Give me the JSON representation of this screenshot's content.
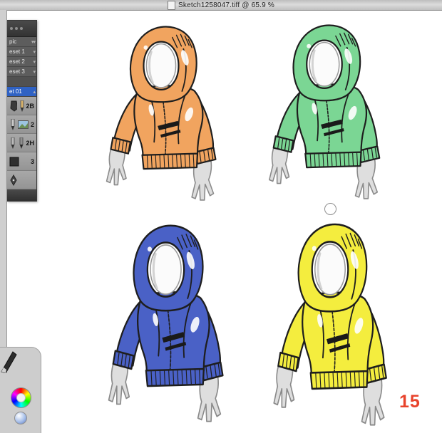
{
  "window": {
    "title": "Sketch1258047.tiff @ 65.9 %"
  },
  "palette": {
    "rows": [
      {
        "label": "pic"
      },
      {
        "label": "eset 1"
      },
      {
        "label": "eset 2"
      },
      {
        "label": "eset 3"
      }
    ],
    "selected_row": {
      "label": "et 01"
    },
    "brushes": [
      {
        "label": "2B"
      },
      {
        "label": "2"
      },
      {
        "label": "2H"
      },
      {
        "label": "3"
      }
    ]
  },
  "canvas": {
    "page_number": "15",
    "hoodies": [
      {
        "name": "hoodie-orange",
        "color": "#F1A45F"
      },
      {
        "name": "hoodie-green",
        "color": "#7BD694"
      },
      {
        "name": "hoodie-blue",
        "color": "#4A61C6"
      },
      {
        "name": "hoodie-yellow",
        "color": "#F4ED3E"
      }
    ]
  },
  "colors": {
    "selection_blue": "#2F62C4",
    "page_number_red": "#E8432C"
  }
}
